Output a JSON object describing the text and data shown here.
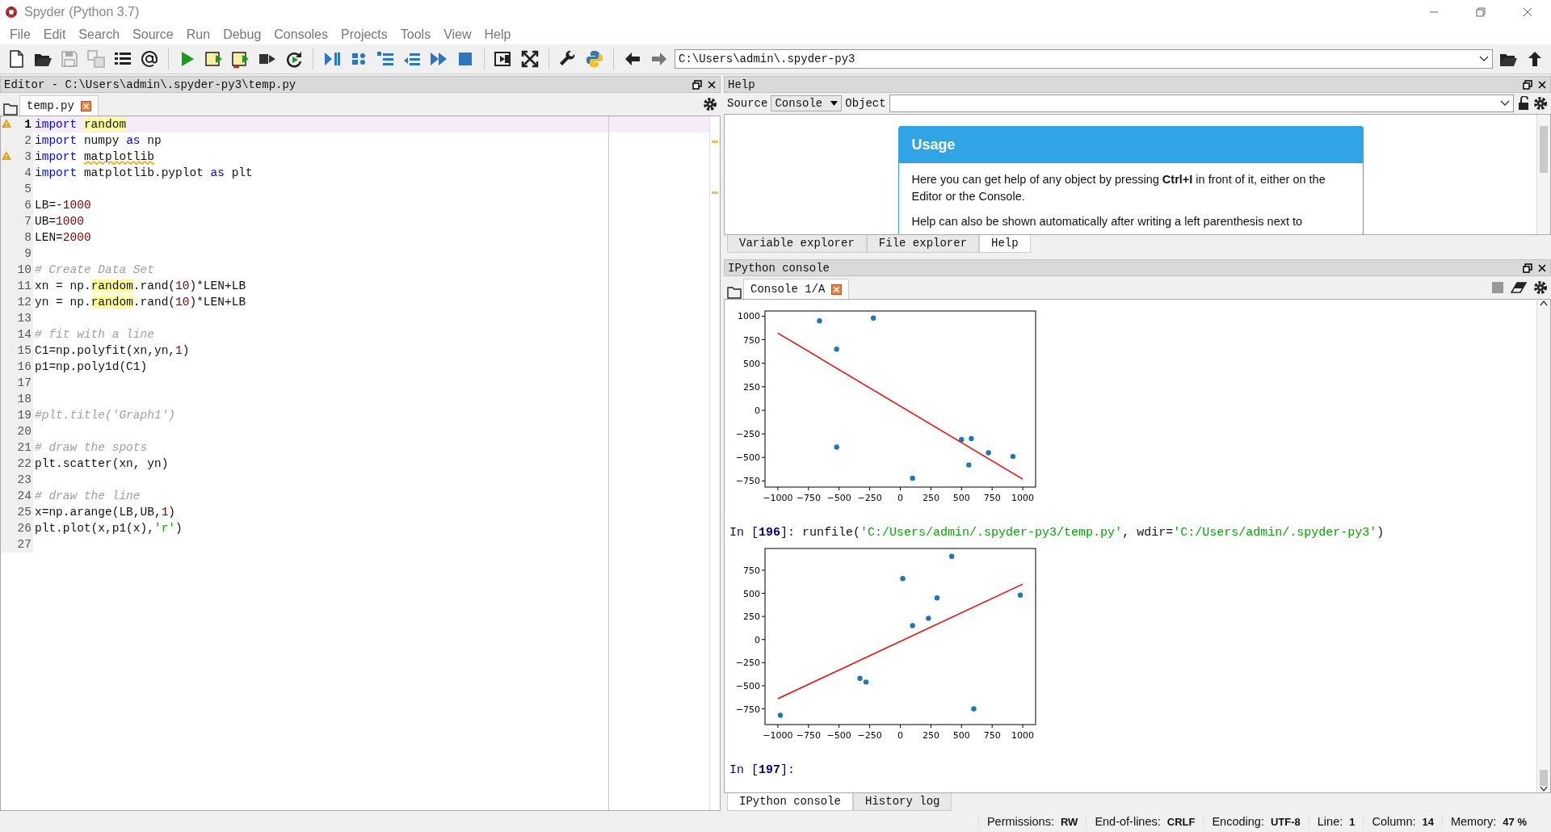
{
  "window": {
    "title": "Spyder (Python 3.7)"
  },
  "menu": [
    {
      "label": "File"
    },
    {
      "label": "Edit"
    },
    {
      "label": "Search"
    },
    {
      "label": "Source"
    },
    {
      "label": "Run"
    },
    {
      "label": "Debug"
    },
    {
      "label": "Consoles"
    },
    {
      "label": "Projects"
    },
    {
      "label": "Tools"
    },
    {
      "label": "View"
    },
    {
      "label": "Help"
    }
  ],
  "toolbar": {
    "path": "C:\\Users\\admin\\.spyder-py3"
  },
  "editor": {
    "title": "Editor - C:\\Users\\admin\\.spyder-py3\\temp.py",
    "tabs": [
      {
        "label": "temp.py",
        "selected": true
      }
    ],
    "lines": [
      {
        "number": "1",
        "current": true,
        "warning": true,
        "tokens": [
          {
            "kind": "kw",
            "text": "import "
          },
          {
            "kind": "match",
            "text": "random"
          }
        ]
      },
      {
        "number": "2",
        "current": false,
        "warning": false,
        "tokens": [
          {
            "kind": "kw",
            "text": "import"
          },
          {
            "kind": "plain",
            "text": " numpy "
          },
          {
            "kind": "kw",
            "text": "as"
          },
          {
            "kind": "plain",
            "text": " np"
          }
        ]
      },
      {
        "number": "3",
        "current": false,
        "warning": true,
        "tokens": [
          {
            "kind": "kw",
            "text": "import "
          },
          {
            "kind": "warn",
            "text": "matplotlib"
          }
        ]
      },
      {
        "number": "4",
        "current": false,
        "warning": false,
        "tokens": [
          {
            "kind": "kw",
            "text": "import"
          },
          {
            "kind": "plain",
            "text": " matplotlib.pyplot "
          },
          {
            "kind": "kw",
            "text": "as"
          },
          {
            "kind": "plain",
            "text": " plt"
          }
        ]
      },
      {
        "number": "5",
        "current": false,
        "warning": false
      },
      {
        "number": "6",
        "current": false,
        "warning": false,
        "tokens": [
          {
            "kind": "plain",
            "text": "LB=-"
          },
          {
            "kind": "num",
            "text": "1000"
          }
        ]
      },
      {
        "number": "7",
        "current": false,
        "warning": false,
        "tokens": [
          {
            "kind": "plain",
            "text": "UB="
          },
          {
            "kind": "num",
            "text": "1000"
          }
        ]
      },
      {
        "number": "8",
        "current": false,
        "warning": false,
        "tokens": [
          {
            "kind": "plain",
            "text": "LEN="
          },
          {
            "kind": "num",
            "text": "2000"
          }
        ]
      },
      {
        "number": "9",
        "current": false,
        "warning": false
      },
      {
        "number": "10",
        "current": false,
        "warning": false,
        "tokens": [
          {
            "kind": "comment",
            "text": "# Create Data Set"
          }
        ]
      },
      {
        "number": "11",
        "current": false,
        "warning": false,
        "tokens": [
          {
            "kind": "plain",
            "text": "xn = np."
          },
          {
            "kind": "match",
            "text": "random"
          },
          {
            "kind": "plain",
            "text": ".rand("
          },
          {
            "kind": "num",
            "text": "10"
          },
          {
            "kind": "plain",
            "text": ")*LEN+LB"
          }
        ]
      },
      {
        "number": "12",
        "current": false,
        "warning": false,
        "tokens": [
          {
            "kind": "plain",
            "text": "yn = np."
          },
          {
            "kind": "match",
            "text": "random"
          },
          {
            "kind": "plain",
            "text": ".rand("
          },
          {
            "kind": "num",
            "text": "10"
          },
          {
            "kind": "plain",
            "text": ")*LEN+LB"
          }
        ]
      },
      {
        "number": "13",
        "current": false,
        "warning": false
      },
      {
        "number": "14",
        "current": false,
        "warning": false,
        "tokens": [
          {
            "kind": "comment",
            "text": "# fit with a line"
          }
        ]
      },
      {
        "number": "15",
        "current": false,
        "warning": false,
        "tokens": [
          {
            "kind": "plain",
            "text": "C1=np.polyfit(xn,yn,"
          },
          {
            "kind": "num",
            "text": "1"
          },
          {
            "kind": "plain",
            "text": ")"
          }
        ]
      },
      {
        "number": "16",
        "current": false,
        "warning": false,
        "tokens": [
          {
            "kind": "plain",
            "text": "p1=np.poly1d(C1)"
          }
        ]
      },
      {
        "number": "17",
        "current": false,
        "warning": false
      },
      {
        "number": "18",
        "current": false,
        "warning": false
      },
      {
        "number": "19",
        "current": false,
        "warning": false,
        "tokens": [
          {
            "kind": "comment",
            "text": "#plt.title('Graph1')"
          }
        ]
      },
      {
        "number": "20",
        "current": false,
        "warning": false
      },
      {
        "number": "21",
        "current": false,
        "warning": false,
        "tokens": [
          {
            "kind": "comment",
            "text": "# draw the spots"
          }
        ]
      },
      {
        "number": "22",
        "current": false,
        "warning": false,
        "tokens": [
          {
            "kind": "plain",
            "text": "plt.scatter(xn, yn)"
          }
        ]
      },
      {
        "number": "23",
        "current": false,
        "warning": false
      },
      {
        "number": "24",
        "current": false,
        "warning": false,
        "tokens": [
          {
            "kind": "comment",
            "text": "# draw the line"
          }
        ]
      },
      {
        "number": "25",
        "current": false,
        "warning": false,
        "tokens": [
          {
            "kind": "plain",
            "text": "x=np.arange(LB,UB,"
          },
          {
            "kind": "num",
            "text": "1"
          },
          {
            "kind": "plain",
            "text": ")"
          }
        ]
      },
      {
        "number": "26",
        "current": false,
        "warning": false,
        "tokens": [
          {
            "kind": "plain",
            "text": "plt.plot(x,p1(x),"
          },
          {
            "kind": "str",
            "text": "'r'"
          },
          {
            "kind": "plain",
            "text": ")"
          }
        ]
      },
      {
        "number": "27",
        "current": false,
        "warning": false
      }
    ]
  },
  "help": {
    "title": "Help",
    "source_label": "Source",
    "source_value": "Console",
    "object_label": "Object",
    "usage": {
      "heading": "Usage",
      "paragraphs": [
        "Here you can get help of any object by pressing **Ctrl+I** in front of it, either on the Editor or the Console.",
        "Help can also be shown automatically after writing a left parenthesis next to"
      ]
    },
    "tabs": [
      {
        "label": "Variable explorer",
        "selected": false
      },
      {
        "label": "File explorer",
        "selected": false
      },
      {
        "label": "Help",
        "selected": true
      }
    ]
  },
  "console": {
    "title": "IPython console",
    "tabs": [
      {
        "label": "Console 1/A",
        "selected": true
      }
    ],
    "outputs": [
      {
        "kind": "plot",
        "chart_data": {
          "type": "scatter",
          "xlim": [
            -1105,
            1105
          ],
          "ylim": [
            -815,
            1055
          ],
          "xticks": [
            {
              "value": -1000,
              "label": "−1000"
            },
            {
              "value": -750,
              "label": "−750"
            },
            {
              "value": -500,
              "label": "−500"
            },
            {
              "value": -250,
              "label": "−250"
            },
            {
              "value": 0,
              "label": "0"
            },
            {
              "value": 250,
              "label": "250"
            },
            {
              "value": 500,
              "label": "500"
            },
            {
              "value": 750,
              "label": "750"
            },
            {
              "value": 1000,
              "label": "1000"
            }
          ],
          "yticks": [
            {
              "value": -750,
              "label": "−750"
            },
            {
              "value": -500,
              "label": "−500"
            },
            {
              "value": -250,
              "label": "−250"
            },
            {
              "value": 0,
              "label": "0"
            },
            {
              "value": 250,
              "label": "250"
            },
            {
              "value": 500,
              "label": "500"
            },
            {
              "value": 750,
              "label": "750"
            },
            {
              "value": 1000,
              "label": "1000"
            }
          ],
          "series": [
            {
              "type": "scatter",
              "color": "#1f77b4",
              "x": [
                -660,
                -220,
                -520,
                -520,
                100,
                500,
                580,
                720,
                560,
                920
              ],
              "values": [
                950,
                980,
                650,
                -390,
                -720,
                -310,
                -300,
                -450,
                -580,
                -490
              ]
            },
            {
              "type": "line",
              "color": "#ff0000",
              "x": [
                -1000,
                1000
              ],
              "values": [
                820,
                -730
              ]
            }
          ]
        }
      },
      {
        "kind": "input",
        "tokens": [
          {
            "kind": "prompt",
            "text": "In ["
          },
          {
            "kind": "prompt_num",
            "text": "196"
          },
          {
            "kind": "prompt",
            "text": "]: "
          },
          {
            "kind": "plain",
            "text": "runfile("
          },
          {
            "kind": "str",
            "text": "'C:/Users/admin/.spyder-py3/temp.py'"
          },
          {
            "kind": "plain",
            "text": ", wdir="
          },
          {
            "kind": "str",
            "text": "'C:/Users/admin/.spyder-py3'"
          },
          {
            "kind": "plain",
            "text": ")"
          }
        ]
      },
      {
        "kind": "plot",
        "chart_data": {
          "type": "scatter",
          "xlim": [
            -1105,
            1105
          ],
          "ylim": [
            -920,
            985
          ],
          "xticks": [
            {
              "value": -1000,
              "label": "−1000"
            },
            {
              "value": -750,
              "label": "−750"
            },
            {
              "value": -500,
              "label": "−500"
            },
            {
              "value": -250,
              "label": "−250"
            },
            {
              "value": 0,
              "label": "0"
            },
            {
              "value": 250,
              "label": "250"
            },
            {
              "value": 500,
              "label": "500"
            },
            {
              "value": 750,
              "label": "750"
            },
            {
              "value": 1000,
              "label": "1000"
            }
          ],
          "yticks": [
            {
              "value": -750,
              "label": "−750"
            },
            {
              "value": -500,
              "label": "−500"
            },
            {
              "value": -250,
              "label": "−250"
            },
            {
              "value": 0,
              "label": "0"
            },
            {
              "value": 250,
              "label": "250"
            },
            {
              "value": 500,
              "label": "500"
            },
            {
              "value": 750,
              "label": "750"
            }
          ],
          "series": [
            {
              "type": "scatter",
              "color": "#1f77b4",
              "x": [
                -980,
                -330,
                -280,
                20,
                100,
                230,
                300,
                420,
                600,
                980
              ],
              "values": [
                -820,
                -420,
                -460,
                660,
                150,
                230,
                450,
                900,
                -750,
                480
              ]
            },
            {
              "type": "line",
              "color": "#ff0000",
              "x": [
                -1000,
                1000
              ],
              "values": [
                -640,
                600
              ]
            }
          ]
        }
      },
      {
        "kind": "input",
        "tokens": [
          {
            "kind": "prompt",
            "text": "In ["
          },
          {
            "kind": "prompt_num",
            "text": "197"
          },
          {
            "kind": "prompt",
            "text": "]:"
          }
        ]
      }
    ],
    "bottom_tabs": [
      {
        "label": "IPython console",
        "selected": true
      },
      {
        "label": "History log",
        "selected": false
      }
    ]
  },
  "status_bar": [
    {
      "label": "Permissions:",
      "value": "RW"
    },
    {
      "label": "End-of-lines:",
      "value": "CRLF"
    },
    {
      "label": "Encoding:",
      "value": "UTF-8"
    },
    {
      "label": "Line:",
      "value": "1"
    },
    {
      "label": "Column:",
      "value": "14"
    },
    {
      "label": "Memory:",
      "value": "47 %"
    }
  ]
}
